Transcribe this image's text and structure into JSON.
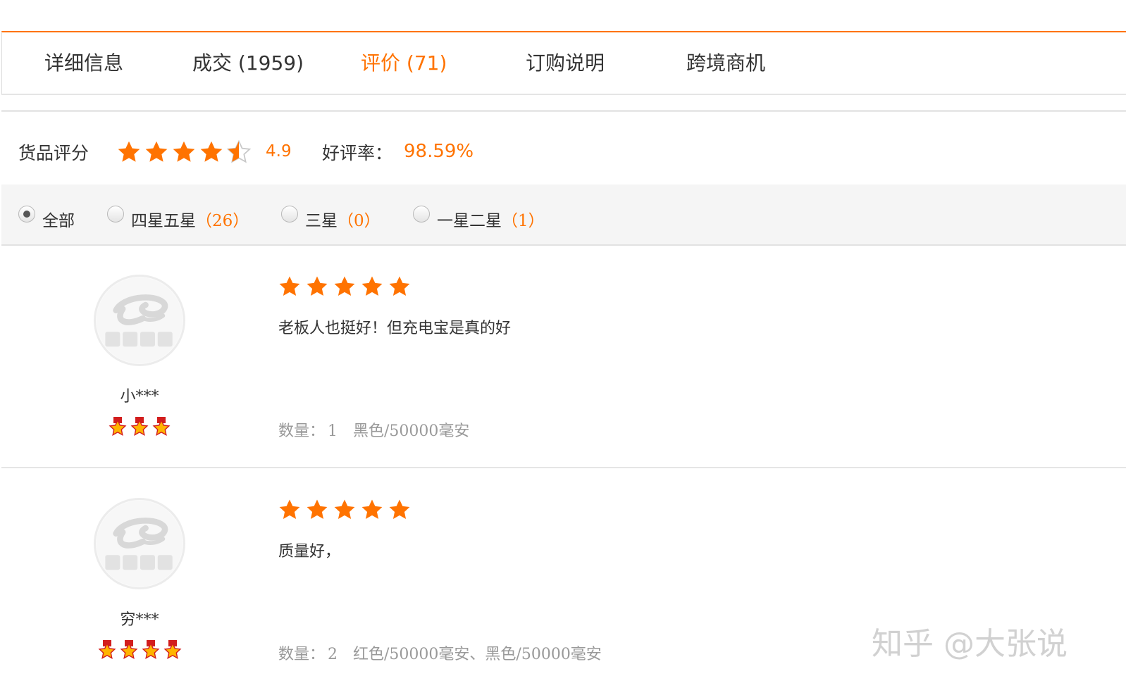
{
  "tabs": [
    {
      "label": "详细信息",
      "active": false
    },
    {
      "label": "成交 (1959)",
      "active": false
    },
    {
      "label": "评价 (71)",
      "active": true
    },
    {
      "label": "订购说明",
      "active": false
    },
    {
      "label": "跨境商机",
      "active": false
    }
  ],
  "summary": {
    "score_label": "货品评分",
    "score_value": "4.9",
    "score_stars": 4.5,
    "good_rate_label": "好评率：",
    "good_rate_value": "98.59%"
  },
  "filter": {
    "options": [
      {
        "label": "全部",
        "count": "",
        "checked": true
      },
      {
        "label": "四星五星",
        "count": "（26）",
        "checked": false
      },
      {
        "label": "三星",
        "count": "（0）",
        "checked": false
      },
      {
        "label": "一星二星",
        "count": "（1）",
        "checked": false
      }
    ]
  },
  "reviews": [
    {
      "username": "小***",
      "avatar_icon": "alibaba-logo-avatar",
      "buyer_medals": 3,
      "stars": 5,
      "text": "老板人也挺好！但充电宝是真的好",
      "quantity_label": "数量：",
      "quantity": "1",
      "spec": "黑色/50000毫安"
    },
    {
      "username": "穷***",
      "avatar_icon": "alibaba-logo-avatar",
      "buyer_medals": 4,
      "stars": 5,
      "text": "质量好，",
      "quantity_label": "数量：",
      "quantity": "2",
      "spec": "红色/50000毫安、黑色/50000毫安"
    }
  ],
  "watermark": "知乎 @大张说",
  "colors": {
    "accent": "#ff7300",
    "star": "#ff7300",
    "muted": "#999999"
  }
}
